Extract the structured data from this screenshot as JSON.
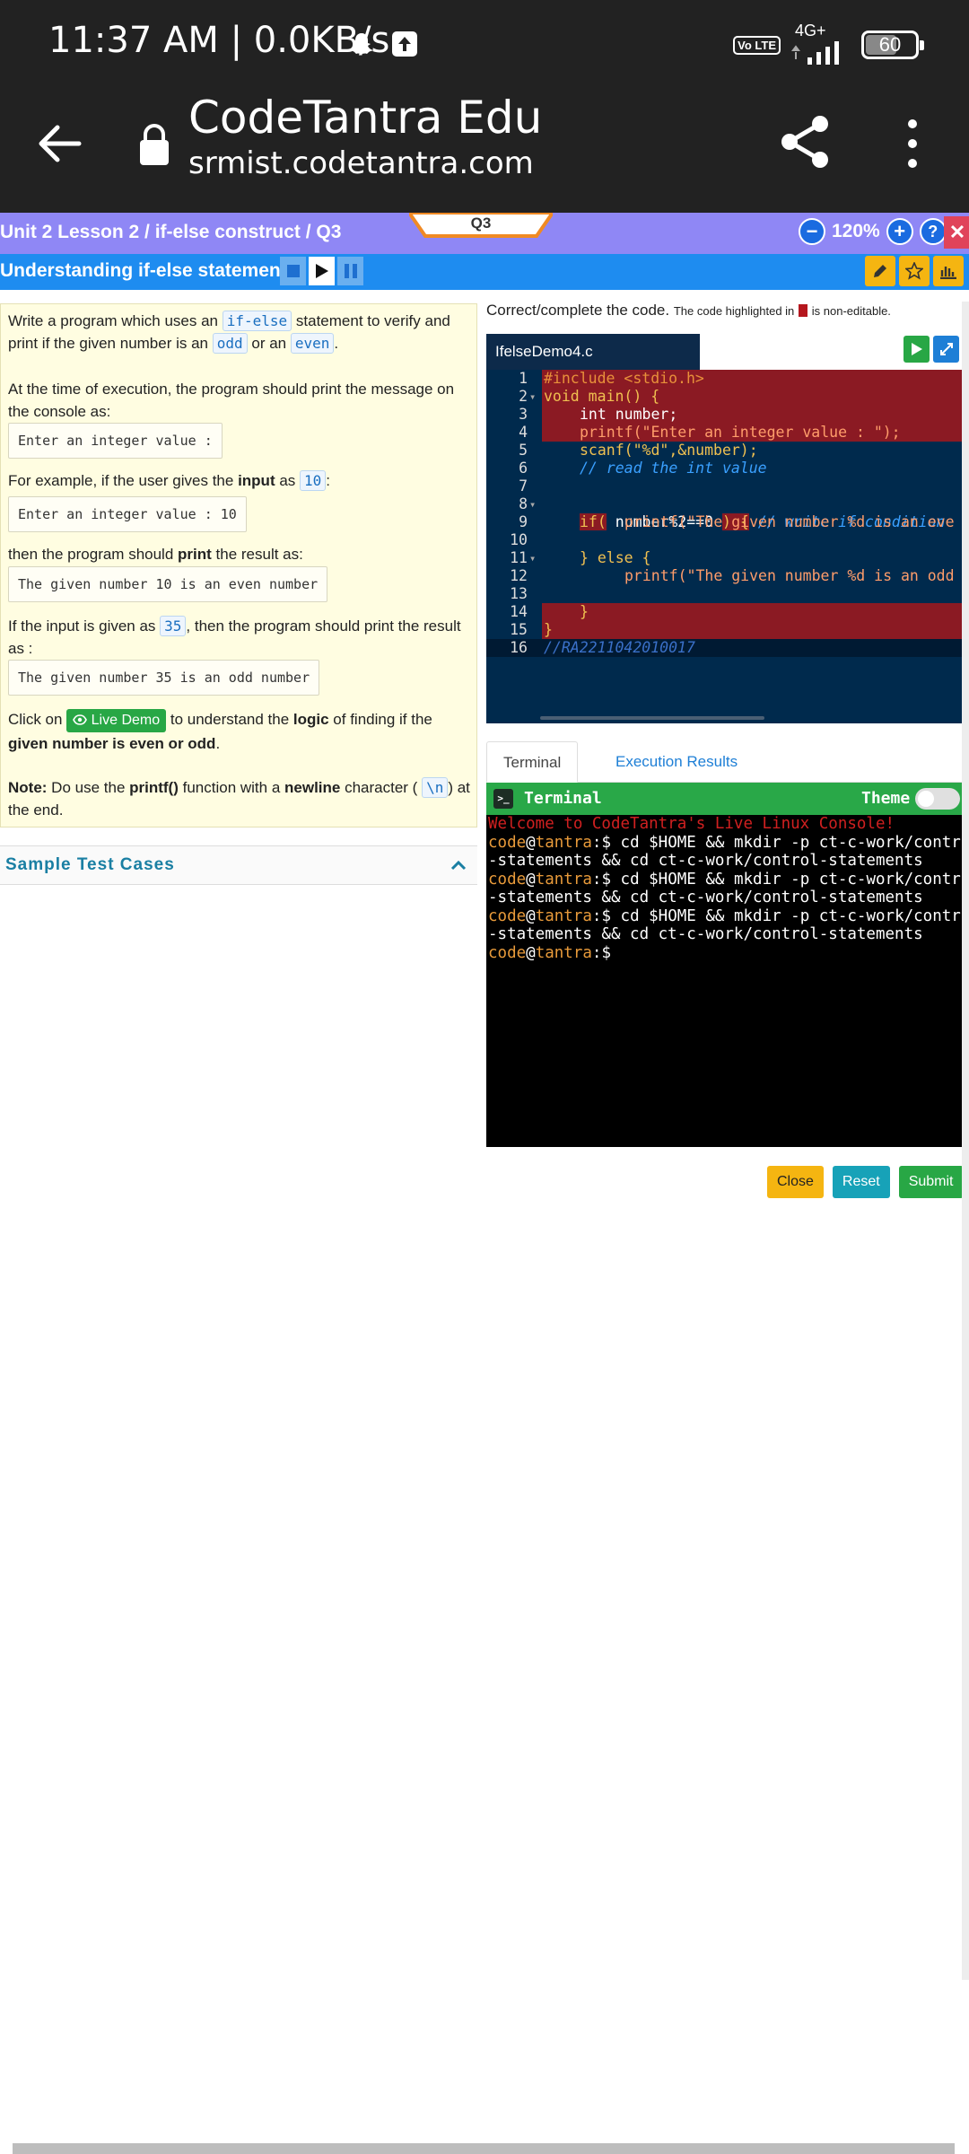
{
  "status_bar": {
    "time": "11:37 AM | 0.0KB/s",
    "network": "4G+",
    "volte": "Vo LTE",
    "battery": "60"
  },
  "browser": {
    "site_title": "CodeTantra Edu",
    "url": "srmist.codetantra.com"
  },
  "lesson": {
    "breadcrumb": "Unit 2 Lesson 2 / if-else construct / Q3",
    "question_tab": "Q3",
    "zoom": "120%",
    "title": "Understanding if-else statement"
  },
  "problem": {
    "p1_a": "Write a program which uses an ",
    "p1_code1": "if-else",
    "p1_b": " statement to verify and print if the given number is an ",
    "p1_code2": "odd",
    "p1_c": " or an ",
    "p1_code3": "even",
    "p1_d": ".",
    "p2": "At the time of execution, the program should print the message on the console as:",
    "box1": "Enter an integer value :",
    "p3_a": "For example, if the user gives the ",
    "p3_bold": "input",
    "p3_b": " as ",
    "p3_code": "10",
    "p3_c": ":",
    "box2": "Enter an integer value : 10",
    "p4_a": "then the program should ",
    "p4_bold": "print",
    "p4_b": " the result as:",
    "box3": "The given number 10 is an even number",
    "p5_a": "If the input is given as ",
    "p5_code": "35",
    "p5_b": ", then the program should print the result as :",
    "box4": "The given number 35 is an odd number",
    "p6_a": "Click on ",
    "live_demo": "Live Demo",
    "p6_b": " to understand the ",
    "p6_bold1": "logic",
    "p6_c": " of finding if the ",
    "p6_bold2": "given number is even or odd",
    "p6_d": ".",
    "p7_bold1": "Note:",
    "p7_a": " Do use the ",
    "p7_bold2": "printf()",
    "p7_b": " function with a ",
    "p7_bold3": "newline",
    "p7_c": " character ( ",
    "p7_code": "\\n",
    "p7_d": ") at the end."
  },
  "sample_test_cases": "Sample Test Cases",
  "editor": {
    "instruction": "Correct/complete the code.",
    "note_a": "The code highlighted in",
    "note_b": "is non-editable.",
    "filename": "IfelseDemo4.c",
    "lines": [
      "1",
      "2",
      "3",
      "4",
      "5",
      "6",
      "7",
      "8",
      "9",
      "10",
      "11",
      "12",
      "13",
      "14",
      "15",
      "16"
    ],
    "code": {
      "l1": "#include <stdio.h>",
      "l2": "void main() {",
      "l3": "int number;",
      "l4": "printf(\"Enter an integer value : \");",
      "l5": "scanf(\"%d\",&number);",
      "l6": "// read the int value",
      "l8a": "if(",
      "l8b": " number%2==0 ",
      "l8c": ") {",
      "l8d": " // write if condition",
      "l9": "printf(\"The given number %d is an eve",
      "l11": "} else {",
      "l12": "printf(\"The given number %d is an odd",
      "l14": "}",
      "l15": "}",
      "l16": "//RA2211042010017"
    }
  },
  "terminal": {
    "tab_terminal": "Terminal",
    "tab_results": "Execution Results",
    "header": "Terminal",
    "theme_label": "Theme",
    "welcome": "Welcome to CodeTantra's Live Linux Console!",
    "user": "code",
    "at": "@",
    "host": "tantra",
    "prompt": ":$",
    "cmd": " cd $HOME && mkdir -p ct-c-work/control",
    "cmd_cont": "-statements && cd ct-c-work/control-statements"
  },
  "buttons": {
    "close": "Close",
    "reset": "Reset",
    "submit": "Submit"
  },
  "colors": {
    "breadcrumb_bar": "#8f87f5",
    "title_bar": "#1e8cf0",
    "problem_bg": "#fffde1",
    "editor_bg": "#002a4d",
    "readonly_highlight": "#8b1a23",
    "terminal_header": "#29a848"
  }
}
